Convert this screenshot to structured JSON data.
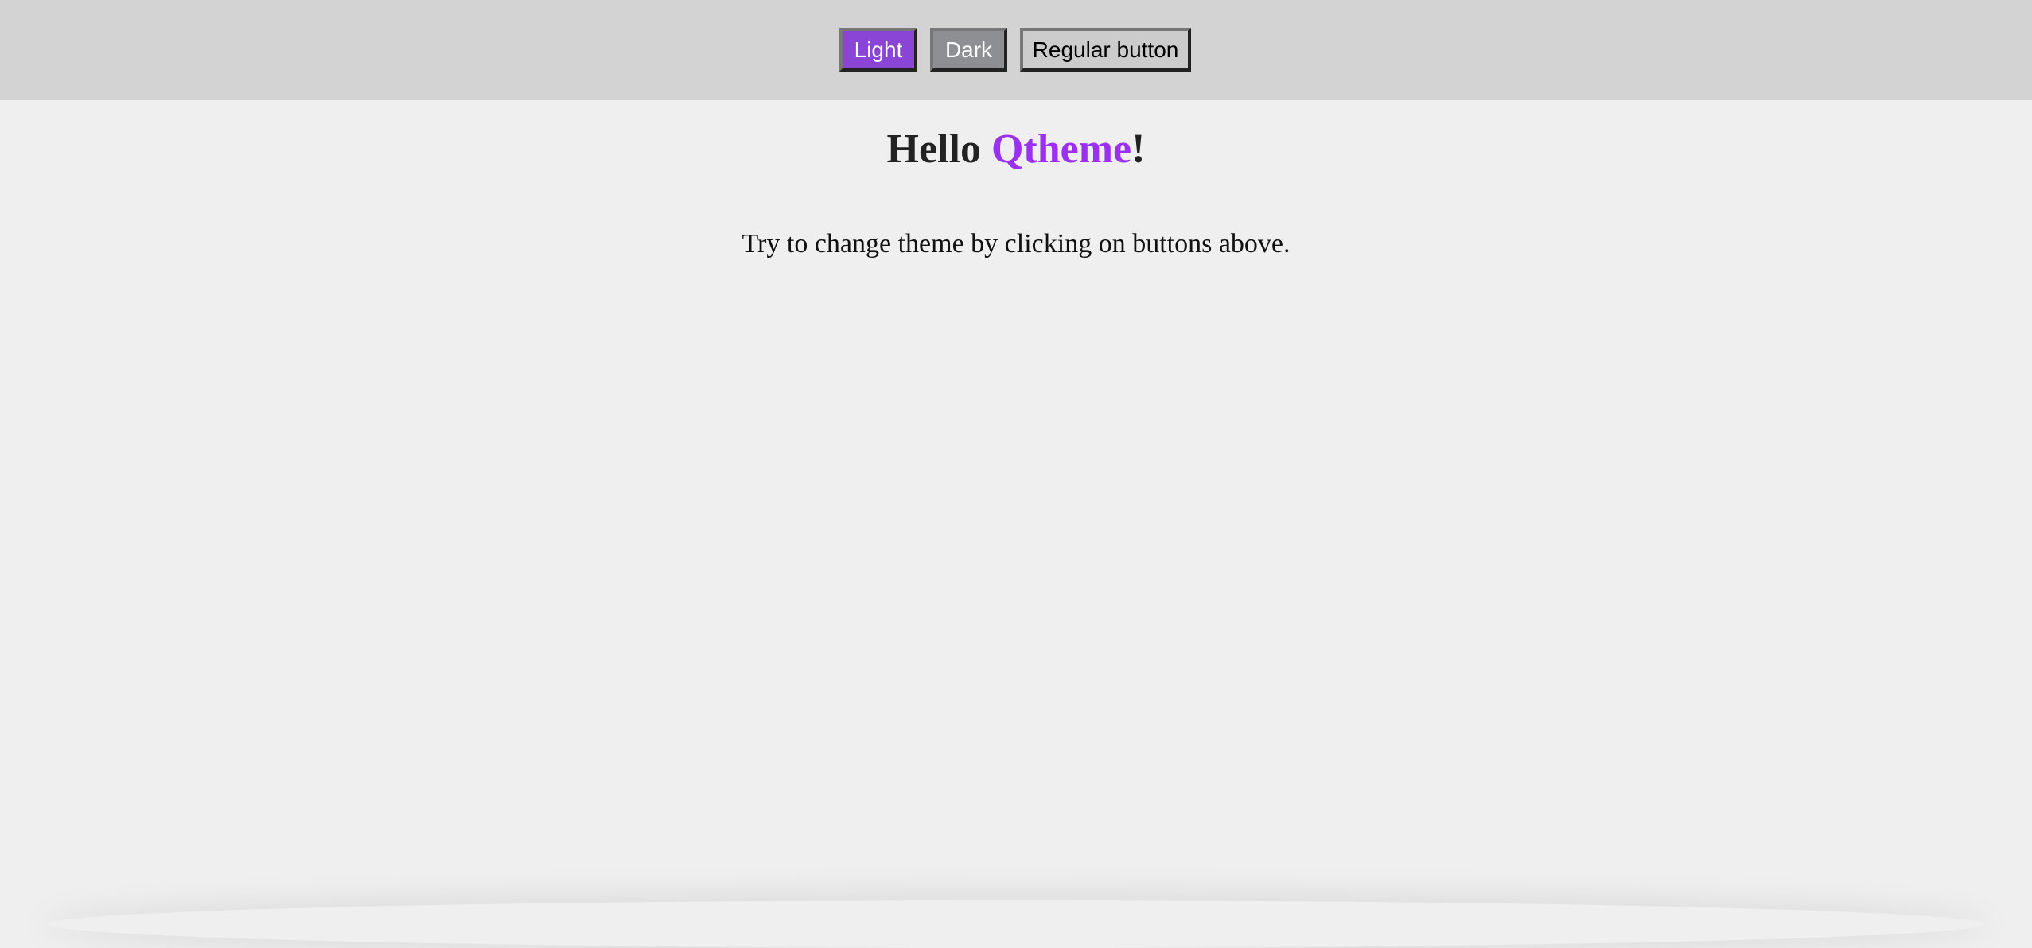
{
  "toolbar": {
    "light_label": "Light",
    "dark_label": "Dark",
    "regular_label": "Regular button"
  },
  "main": {
    "title_prefix": "Hello ",
    "title_accent": "Qtheme",
    "title_suffix": "!",
    "description": "Try to change theme by clicking on buttons above."
  },
  "colors": {
    "accent": "#9b30f0",
    "light_button": "#8a45d6",
    "dark_button": "#8e8f93"
  }
}
